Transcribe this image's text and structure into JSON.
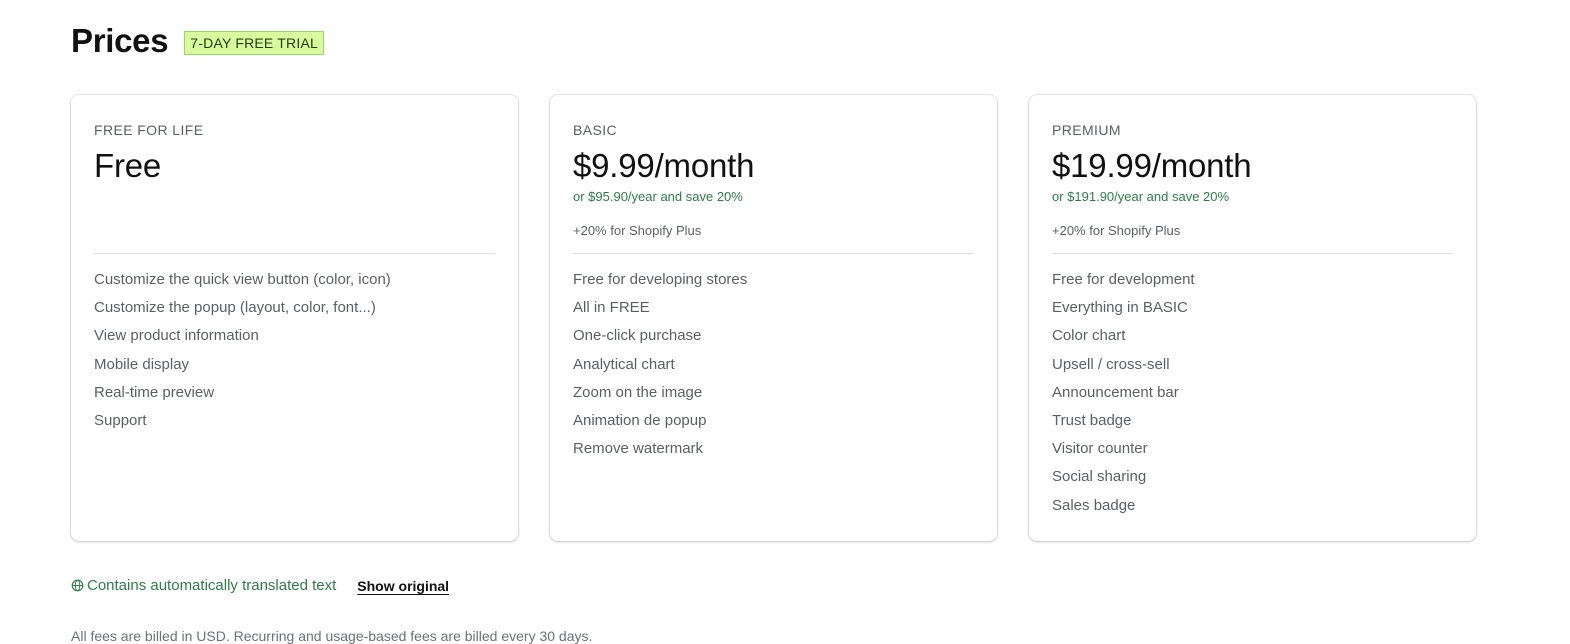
{
  "header": {
    "title": "Prices",
    "badge": "7-DAY FREE TRIAL"
  },
  "plans": [
    {
      "name": "FREE FOR LIFE",
      "price": "Free",
      "yearly": "",
      "extra": "",
      "features": [
        "Customize the quick view button (color, icon)",
        "Customize the popup (layout, color, font...)",
        "View product information",
        "Mobile display",
        "Real-time preview",
        "Support"
      ]
    },
    {
      "name": "BASIC",
      "price": "$9.99/month",
      "yearly": "or $95.90/year and save 20%",
      "extra": "+20% for Shopify Plus",
      "features": [
        "Free for developing stores",
        "All in FREE",
        "One-click purchase",
        "Analytical chart",
        "Zoom on the image",
        "Animation de popup",
        "Remove watermark"
      ]
    },
    {
      "name": "PREMIUM",
      "price": "$19.99/month",
      "yearly": "or $191.90/year and save 20%",
      "extra": "+20% for Shopify Plus",
      "features": [
        "Free for development",
        "Everything in BASIC",
        "Color chart",
        "Upsell / cross-sell",
        "Announcement bar",
        "Trust badge",
        "Visitor counter",
        "Social sharing",
        "Sales badge"
      ]
    }
  ],
  "footer": {
    "translated_notice": "Contains automatically translated text",
    "show_original": "Show original",
    "cut_off_text": "All fees are billed in USD. Recurring and usage-based fees are billed every 30 days."
  },
  "colors": {
    "badge_bg": "#d9fb9e",
    "accent_green": "#2e7d47"
  }
}
